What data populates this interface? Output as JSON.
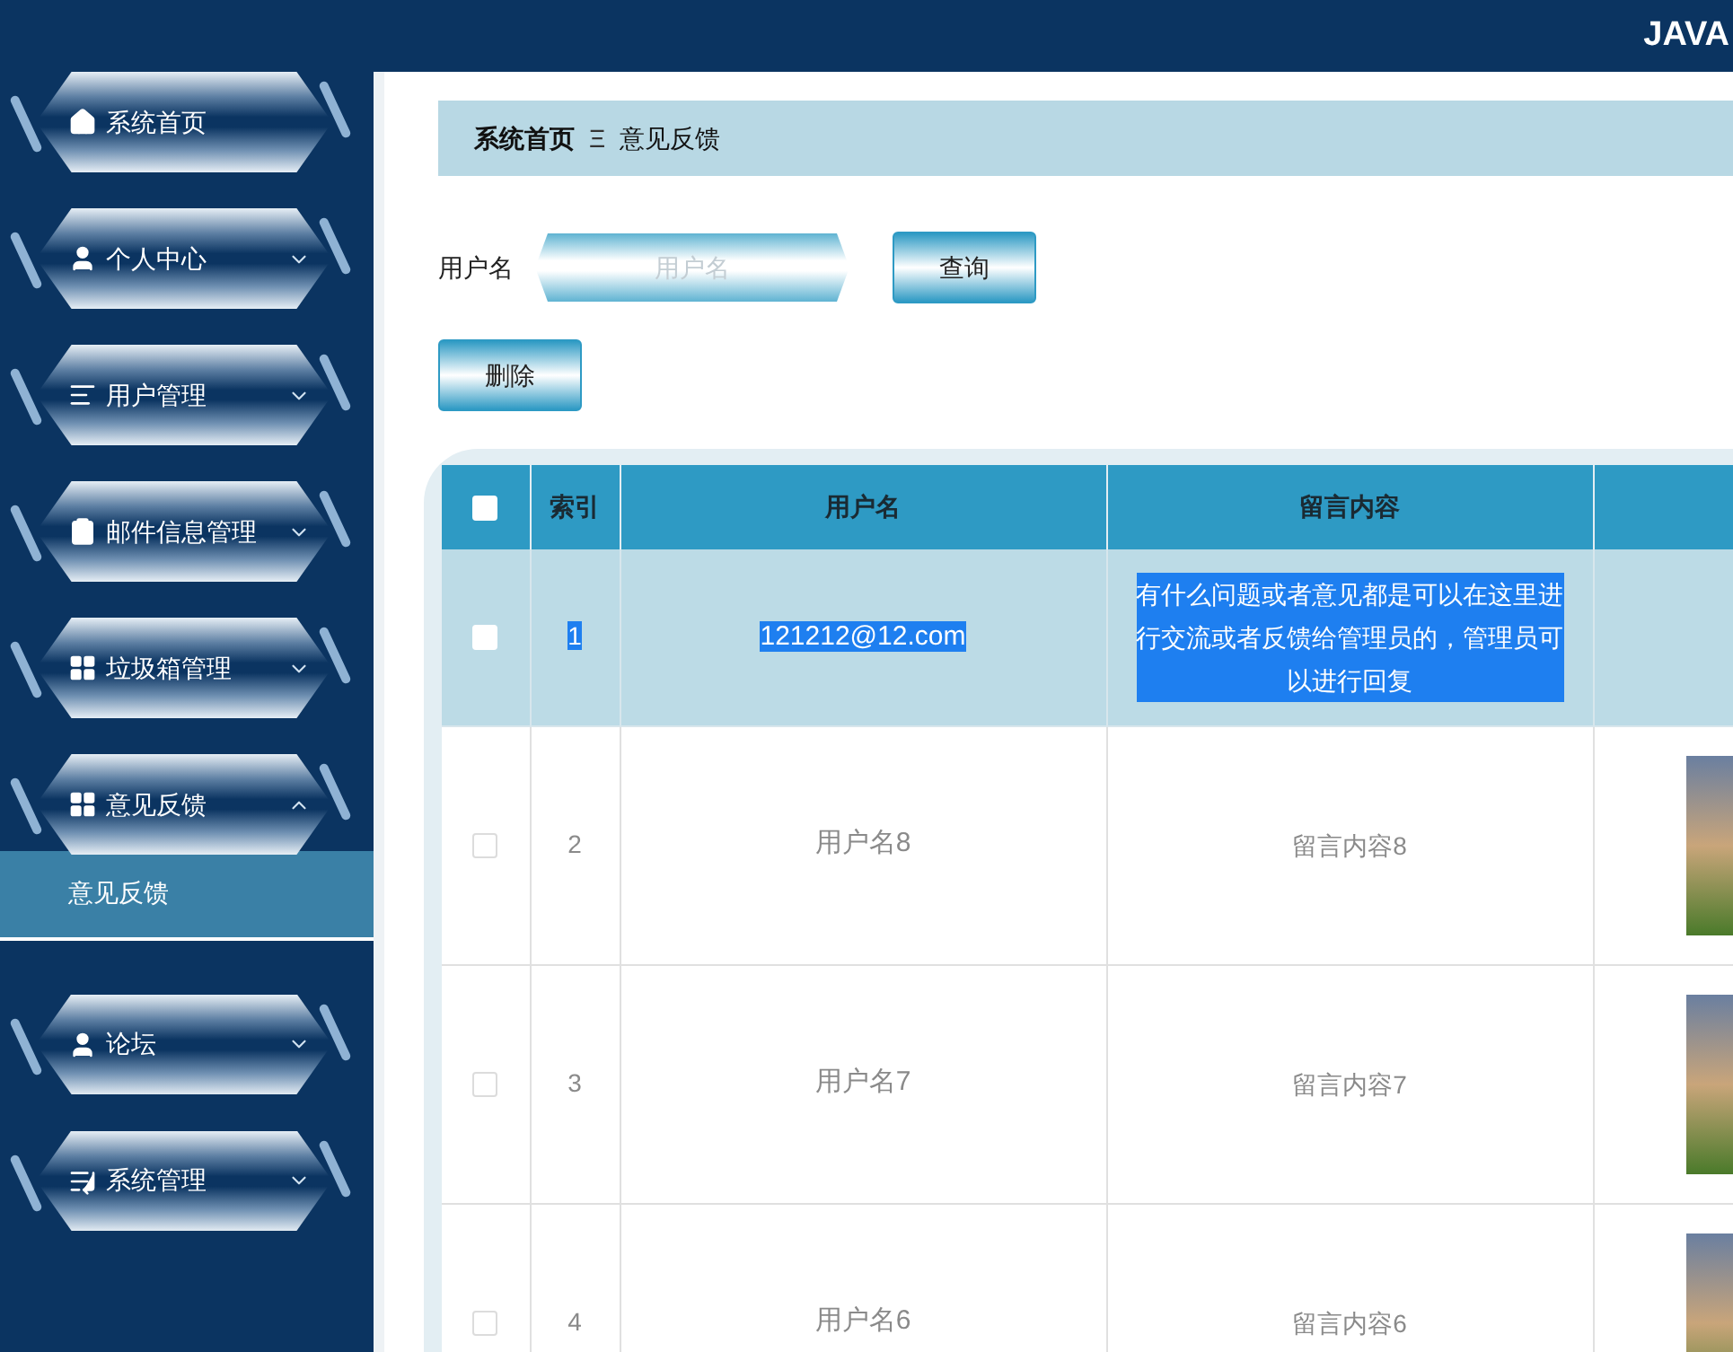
{
  "header": {
    "title": "JAVA"
  },
  "sidebar": {
    "items": [
      {
        "label": "系统首页"
      },
      {
        "label": "个人中心",
        "expanded": false
      },
      {
        "label": "用户管理",
        "expanded": false
      },
      {
        "label": "邮件信息管理",
        "expanded": false
      },
      {
        "label": "垃圾箱管理",
        "expanded": false
      },
      {
        "label": "意见反馈",
        "expanded": true,
        "children": [
          {
            "label": "意见反馈",
            "selected": true
          }
        ]
      },
      {
        "label": "论坛",
        "expanded": false
      },
      {
        "label": "系统管理",
        "expanded": false
      }
    ]
  },
  "breadcrumb": {
    "home": "系统首页",
    "separator": "Ξ",
    "current": "意见反馈"
  },
  "search": {
    "label": "用户名",
    "placeholder": "用户名",
    "button": "查询"
  },
  "delete_button": "删除",
  "table": {
    "header_checked": false,
    "columns": [
      "索引",
      "用户名",
      "留言内容"
    ],
    "rows": [
      {
        "index": "1",
        "username": "121212@12.com",
        "content": "有什么问题或者意见都是可以在这里进行交流或者反馈给管理员的，管理员可以进行回复",
        "checked": false,
        "selected": true,
        "has_photo": false
      },
      {
        "index": "2",
        "username": "用户名8",
        "content": "留言内容8",
        "checked": false,
        "selected": false,
        "has_photo": true
      },
      {
        "index": "3",
        "username": "用户名7",
        "content": "留言内容7",
        "checked": false,
        "selected": false,
        "has_photo": true
      },
      {
        "index": "4",
        "username": "用户名6",
        "content": "留言内容6",
        "checked": false,
        "selected": false,
        "has_photo": true
      }
    ]
  }
}
